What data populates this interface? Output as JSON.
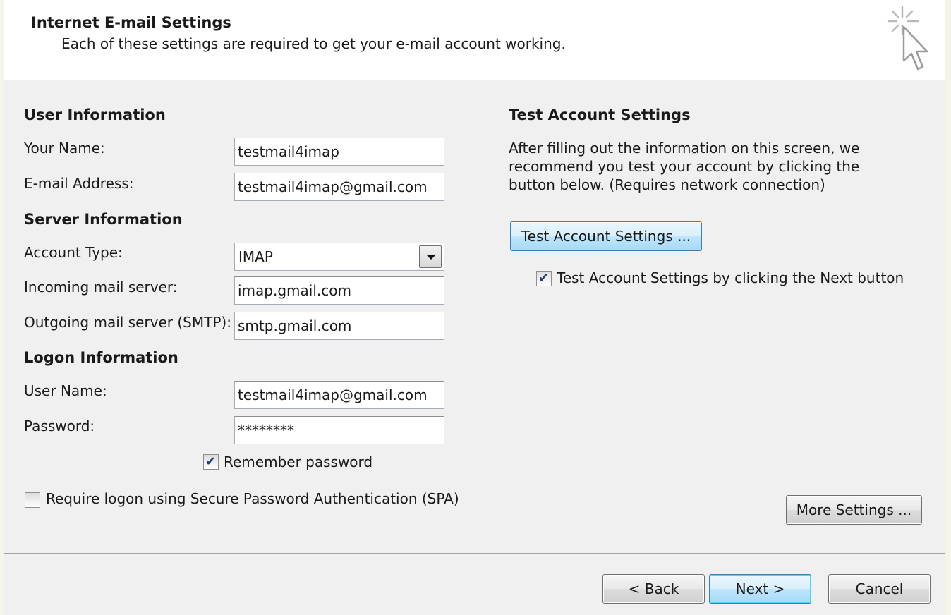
{
  "header": {
    "title": "Internet E-mail Settings",
    "subtitle": "Each of these settings are required to get your e-mail account working.",
    "icon": "cursor-sparkle-icon"
  },
  "user_info": {
    "title": "User Information",
    "name_label": "Your Name:",
    "name_value": "testmail4imap",
    "email_label": "E-mail Address:",
    "email_value": "testmail4imap@gmail.com"
  },
  "server_info": {
    "title": "Server Information",
    "account_type_label": "Account Type:",
    "account_type_value": "IMAP",
    "incoming_label": "Incoming mail server:",
    "incoming_value": "imap.gmail.com",
    "outgoing_label": "Outgoing mail server (SMTP):",
    "outgoing_value": "smtp.gmail.com"
  },
  "logon_info": {
    "title": "Logon Information",
    "username_label": "User Name:",
    "username_value": "testmail4imap@gmail.com",
    "password_label": "Password:",
    "password_value": "********",
    "remember_label": "Remember password",
    "remember_checked": true,
    "spa_label": "Require logon using Secure Password Authentication (SPA)",
    "spa_checked": false
  },
  "test_settings": {
    "title": "Test Account Settings",
    "description": "After filling out the information on this screen, we recommend you test your account by clicking the button below. (Requires network connection)",
    "button_label": "Test Account Settings ...",
    "next_checkbox_label": "Test Account Settings by clicking the Next button",
    "next_checkbox_checked": true
  },
  "more_settings_label": "More Settings ...",
  "footer": {
    "back_label": "< Back",
    "next_label": "Next >",
    "cancel_label": "Cancel"
  },
  "colors": {
    "header_bg": "#ffffff",
    "dialog_bg": "#f0f0f0",
    "focus_border": "#3c7fb1",
    "check_color": "#203d79"
  }
}
